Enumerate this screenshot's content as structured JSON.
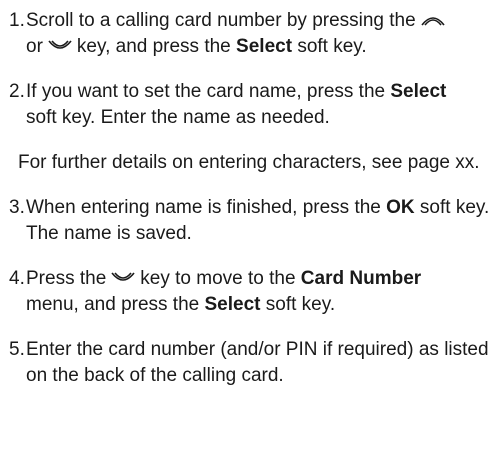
{
  "steps": [
    {
      "num": "1.",
      "t1": "Scroll to a calling card number by pressing the",
      "t2": "or",
      "t3": "key, and press the",
      "b1": "Select",
      "t4": "soft key."
    },
    {
      "num": "2.",
      "t1": "If you want to set the card name, press the",
      "b1": "Select",
      "t2": "soft key. Enter the name as needed."
    },
    {
      "num": "3.",
      "t1": "When entering name is finished, press the",
      "b1": "OK",
      "t2": "soft key. The name is saved."
    },
    {
      "num": "4.",
      "t1": "Press the",
      "t2": "key to move to the",
      "b1": "Card Number",
      "t3": "menu, and press the",
      "b2": "Select",
      "t4": "soft key."
    },
    {
      "num": "5.",
      "t1": "Enter the card number (and/or PIN if required) as listed on the back of the calling card."
    }
  ],
  "note": "For further details on entering characters, see page xx.",
  "icons": {
    "up": "up-arrow-key-icon",
    "down": "down-arrow-key-icon"
  }
}
